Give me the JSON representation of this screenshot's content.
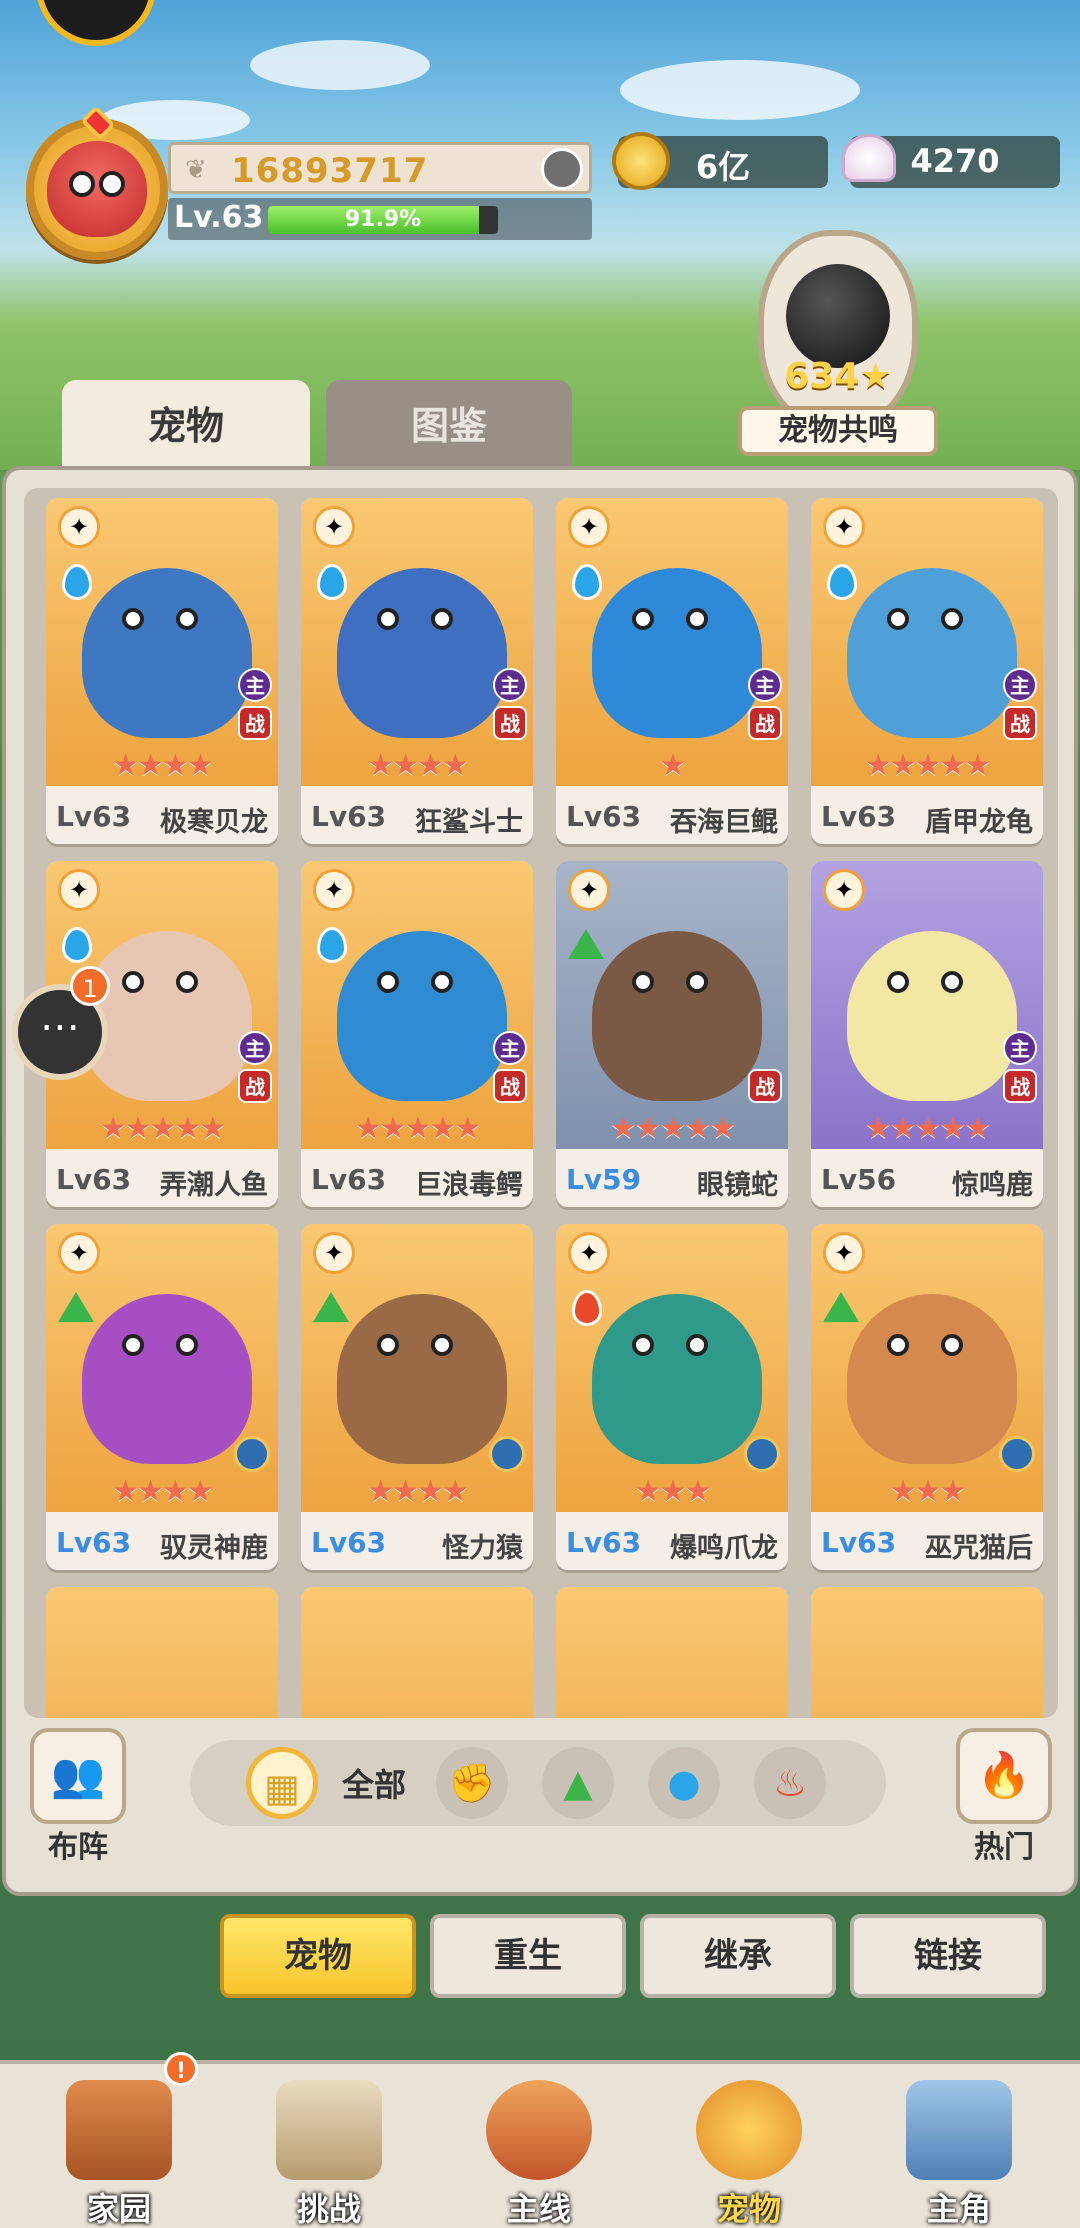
{
  "header": {
    "score": "16893717",
    "level": "Lv.63",
    "exp_percent": "91.9%",
    "exp_fraction": 0.919,
    "gold": "6亿",
    "shells": "4270"
  },
  "resonance": {
    "value": "634",
    "label": "宠物共鸣"
  },
  "tabs": [
    "宠物",
    "图鉴"
  ],
  "pets": [
    {
      "lv": "Lv63",
      "name": "极寒贝龙",
      "stars": "★★★★",
      "el": "drop",
      "main": true,
      "war": true,
      "color": "#3e78c2"
    },
    {
      "lv": "Lv63",
      "name": "狂鲨斗士",
      "stars": "★★★★",
      "el": "drop",
      "main": true,
      "war": true,
      "color": "#3f6fc0"
    },
    {
      "lv": "Lv63",
      "name": "吞海巨鲲",
      "stars": "★",
      "el": "drop",
      "main": true,
      "war": true,
      "color": "#2e8ad9"
    },
    {
      "lv": "Lv63",
      "name": "盾甲龙龟",
      "stars": "★★★★★",
      "el": "drop",
      "main": true,
      "war": true,
      "color": "#4fa0d8"
    },
    {
      "lv": "Lv63",
      "name": "弄潮人鱼",
      "stars": "★★★★★",
      "el": "drop",
      "main": true,
      "war": true,
      "color": "#e7c6b4"
    },
    {
      "lv": "Lv63",
      "name": "巨浪毒鳄",
      "stars": "★★★★★",
      "el": "drop",
      "main": true,
      "war": true,
      "color": "#2f8bd2"
    },
    {
      "lv": "Lv59",
      "name": "眼镜蛇",
      "stars": "★★★★★",
      "el": "tri",
      "main": false,
      "war": true,
      "color": "#7a5a44",
      "bg": "blue",
      "lvblue": true
    },
    {
      "lv": "Lv56",
      "name": "惊鸣鹿",
      "stars": "★★★★★",
      "el": "none",
      "main": true,
      "war": true,
      "color": "#f3e7a4",
      "bg": "purple"
    },
    {
      "lv": "Lv63",
      "name": "驭灵神鹿",
      "stars": "★★★★",
      "el": "tri",
      "main": false,
      "war": false,
      "spin": true,
      "color": "#a74fc2",
      "lvblue": true
    },
    {
      "lv": "Lv63",
      "name": "怪力猿",
      "stars": "★★★★",
      "el": "tri",
      "main": false,
      "war": false,
      "spin": true,
      "color": "#9a6a46",
      "lvblue": true
    },
    {
      "lv": "Lv63",
      "name": "爆鸣爪龙",
      "stars": "★★★",
      "el": "fire",
      "main": false,
      "war": false,
      "spin": true,
      "color": "#2f9a8a",
      "lvblue": true
    },
    {
      "lv": "Lv63",
      "name": "巫咒猫后",
      "stars": "★★★",
      "el": "tri",
      "main": false,
      "war": false,
      "spin": true,
      "color": "#d48a4e",
      "lvblue": true
    }
  ],
  "left_btn": "布阵",
  "right_btn": "热门",
  "filter_all": "全部",
  "chat_badge": "1",
  "actions": [
    "宠物",
    "重生",
    "继承",
    "链接"
  ],
  "nav": [
    "家园",
    "挑战",
    "主线",
    "宠物",
    "主角"
  ],
  "nav_badge": "!"
}
